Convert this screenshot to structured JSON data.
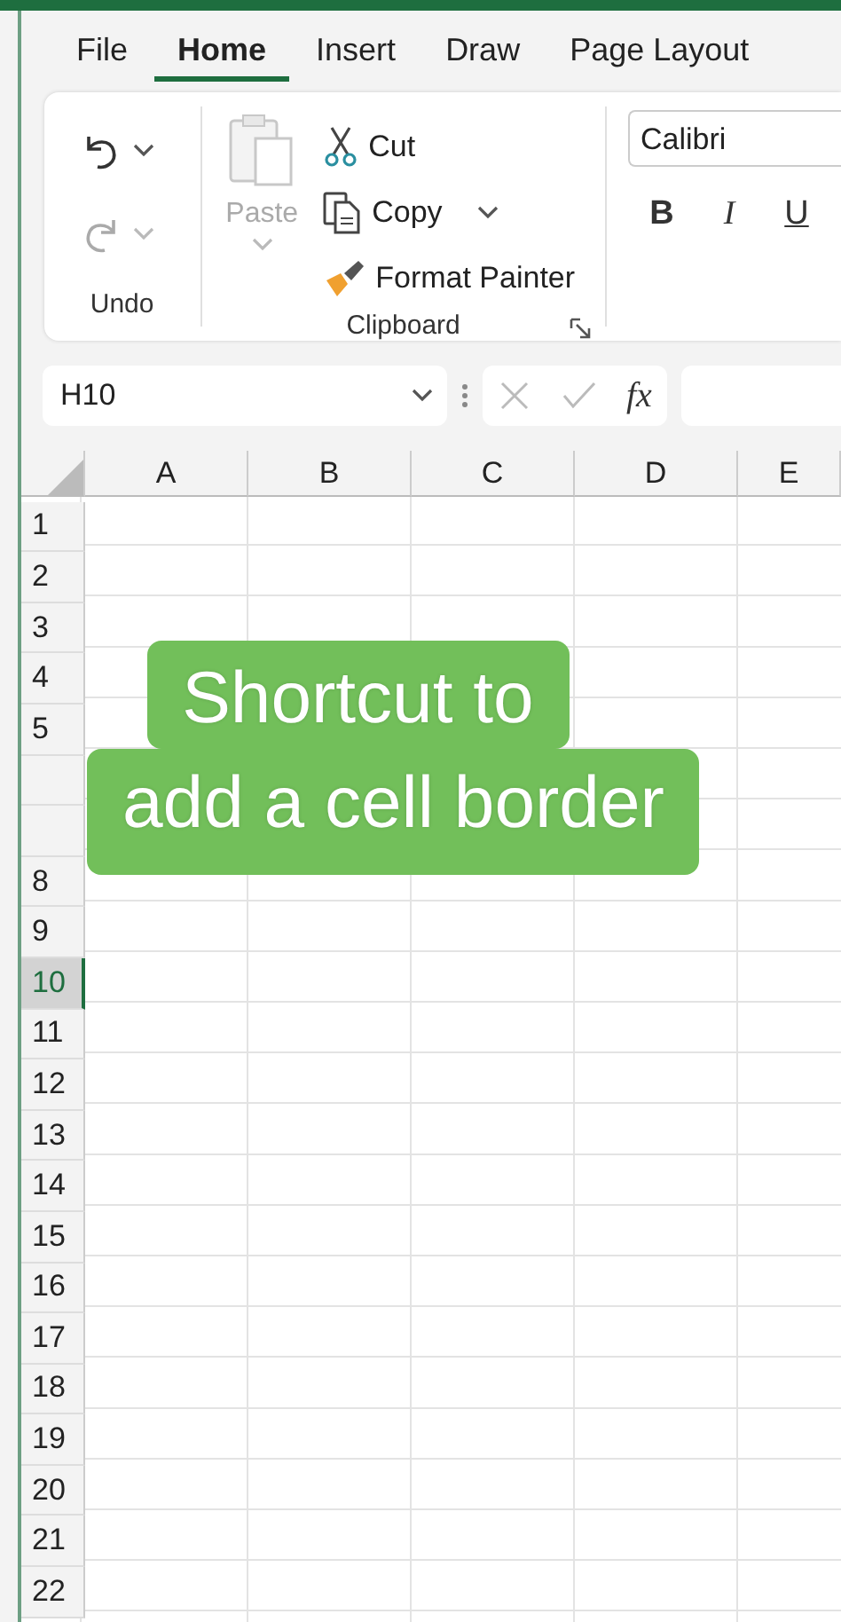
{
  "tabs": [
    {
      "label": "File",
      "selected": false
    },
    {
      "label": "Home",
      "selected": true
    },
    {
      "label": "Insert",
      "selected": false
    },
    {
      "label": "Draw",
      "selected": false
    },
    {
      "label": "Page Layout",
      "selected": false
    }
  ],
  "ribbon": {
    "undo_group": {
      "label": "Undo"
    },
    "clipboard": {
      "label": "Clipboard",
      "paste": {
        "label": "Paste",
        "disabled": true
      },
      "items": [
        {
          "kind": "cut",
          "label": "Cut"
        },
        {
          "kind": "copy",
          "label": "Copy"
        },
        {
          "kind": "painter",
          "label": "Format Painter"
        }
      ]
    },
    "font": {
      "name": "Calibri",
      "styles": [
        {
          "kind": "bold",
          "label": "B"
        },
        {
          "kind": "italic",
          "label": "I"
        },
        {
          "kind": "underline",
          "label": "U"
        }
      ]
    }
  },
  "formula_bar": {
    "name_box": "H10",
    "fx": "fx"
  },
  "sheet": {
    "columns": [
      "A",
      "B",
      "C",
      "D",
      "E"
    ],
    "rows": [
      {
        "label": "1",
        "selected": false
      },
      {
        "label": "2",
        "selected": false
      },
      {
        "label": "3",
        "selected": false
      },
      {
        "label": "4",
        "selected": false
      },
      {
        "label": "5",
        "selected": false
      },
      {
        "selected": false
      },
      {
        "selected": false
      },
      {
        "label": "8",
        "selected": false
      },
      {
        "label": "9",
        "selected": false
      },
      {
        "label": "10",
        "selected": true
      },
      {
        "label": "11",
        "selected": false
      },
      {
        "label": "12",
        "selected": false
      },
      {
        "label": "13",
        "selected": false
      },
      {
        "label": "14",
        "selected": false
      },
      {
        "label": "15",
        "selected": false
      },
      {
        "label": "16",
        "selected": false
      },
      {
        "label": "17",
        "selected": false
      },
      {
        "label": "18",
        "selected": false
      },
      {
        "label": "19",
        "selected": false
      },
      {
        "label": "20",
        "selected": false
      },
      {
        "label": "21",
        "selected": false
      },
      {
        "label": "22",
        "selected": false
      }
    ]
  },
  "caption": {
    "lines": [
      "Shortcut to",
      "add a cell border"
    ]
  }
}
